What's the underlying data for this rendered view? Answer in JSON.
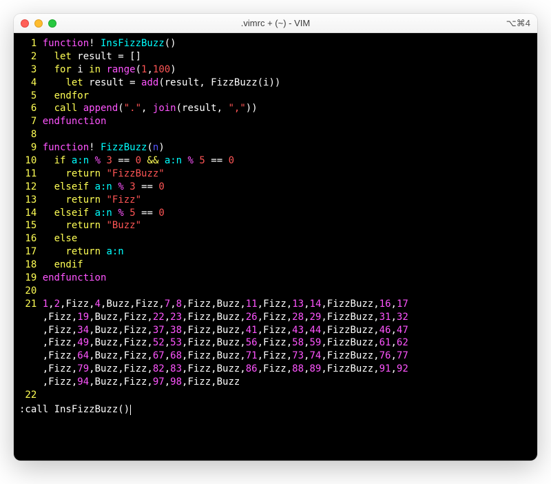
{
  "window": {
    "title": ".vimrc + (~) - VIM",
    "shortcut": "⌥⌘4"
  },
  "colors": {
    "traffic_red": "#ff5f57",
    "traffic_yellow": "#febc2e",
    "traffic_green": "#28c840",
    "bg": "#000000",
    "lineno": "#ffff55",
    "magenta": "#ff55ff",
    "cyan": "#00ffff",
    "yellow": "#ffff55",
    "white": "#ffffff",
    "red": "#ff5555",
    "blue": "#5555ff"
  },
  "editor": {
    "lines": [
      {
        "num": "1",
        "tokens": [
          {
            "t": "function",
            "c": "magenta"
          },
          {
            "t": "!",
            "c": "white"
          },
          {
            "t": " InsFizzBuzz",
            "c": "cyan"
          },
          {
            "t": "()",
            "c": "white"
          }
        ]
      },
      {
        "num": "2",
        "tokens": [
          {
            "t": "  ",
            "c": "white"
          },
          {
            "t": "let",
            "c": "yellow"
          },
          {
            "t": " result ",
            "c": "white"
          },
          {
            "t": "=",
            "c": "white"
          },
          {
            "t": " []",
            "c": "white"
          }
        ]
      },
      {
        "num": "3",
        "tokens": [
          {
            "t": "  ",
            "c": "white"
          },
          {
            "t": "for",
            "c": "yellow"
          },
          {
            "t": " i ",
            "c": "white"
          },
          {
            "t": "in",
            "c": "yellow"
          },
          {
            "t": " ",
            "c": "white"
          },
          {
            "t": "range",
            "c": "magenta"
          },
          {
            "t": "(",
            "c": "white"
          },
          {
            "t": "1",
            "c": "red"
          },
          {
            "t": ",",
            "c": "white"
          },
          {
            "t": "100",
            "c": "red"
          },
          {
            "t": ")",
            "c": "white"
          }
        ]
      },
      {
        "num": "4",
        "tokens": [
          {
            "t": "    ",
            "c": "white"
          },
          {
            "t": "let",
            "c": "yellow"
          },
          {
            "t": " result ",
            "c": "white"
          },
          {
            "t": "=",
            "c": "white"
          },
          {
            "t": " ",
            "c": "white"
          },
          {
            "t": "add",
            "c": "magenta"
          },
          {
            "t": "(result, FizzBuzz(i))",
            "c": "white"
          }
        ]
      },
      {
        "num": "5",
        "tokens": [
          {
            "t": "  ",
            "c": "white"
          },
          {
            "t": "endfor",
            "c": "yellow"
          }
        ]
      },
      {
        "num": "6",
        "tokens": [
          {
            "t": "  ",
            "c": "white"
          },
          {
            "t": "call",
            "c": "yellow"
          },
          {
            "t": " ",
            "c": "white"
          },
          {
            "t": "append",
            "c": "magenta"
          },
          {
            "t": "(",
            "c": "white"
          },
          {
            "t": "\".\"",
            "c": "red"
          },
          {
            "t": ", ",
            "c": "white"
          },
          {
            "t": "join",
            "c": "magenta"
          },
          {
            "t": "(result, ",
            "c": "white"
          },
          {
            "t": "\",\"",
            "c": "red"
          },
          {
            "t": "))",
            "c": "white"
          }
        ]
      },
      {
        "num": "7",
        "tokens": [
          {
            "t": "endfunction",
            "c": "magenta"
          }
        ]
      },
      {
        "num": "8",
        "tokens": []
      },
      {
        "num": "9",
        "tokens": [
          {
            "t": "function",
            "c": "magenta"
          },
          {
            "t": "!",
            "c": "white"
          },
          {
            "t": " FizzBuzz",
            "c": "cyan"
          },
          {
            "t": "(",
            "c": "white"
          },
          {
            "t": "n",
            "c": "blue"
          },
          {
            "t": ")",
            "c": "white"
          }
        ]
      },
      {
        "num": "10",
        "tokens": [
          {
            "t": "  ",
            "c": "white"
          },
          {
            "t": "if",
            "c": "yellow"
          },
          {
            "t": " ",
            "c": "white"
          },
          {
            "t": "a:n",
            "c": "cyan"
          },
          {
            "t": " ",
            "c": "white"
          },
          {
            "t": "%",
            "c": "magenta"
          },
          {
            "t": " ",
            "c": "white"
          },
          {
            "t": "3",
            "c": "red"
          },
          {
            "t": " ",
            "c": "white"
          },
          {
            "t": "==",
            "c": "white"
          },
          {
            "t": " ",
            "c": "white"
          },
          {
            "t": "0",
            "c": "red"
          },
          {
            "t": " ",
            "c": "white"
          },
          {
            "t": "&&",
            "c": "yellow"
          },
          {
            "t": " ",
            "c": "white"
          },
          {
            "t": "a:n",
            "c": "cyan"
          },
          {
            "t": " ",
            "c": "white"
          },
          {
            "t": "%",
            "c": "magenta"
          },
          {
            "t": " ",
            "c": "white"
          },
          {
            "t": "5",
            "c": "red"
          },
          {
            "t": " ",
            "c": "white"
          },
          {
            "t": "==",
            "c": "white"
          },
          {
            "t": " ",
            "c": "white"
          },
          {
            "t": "0",
            "c": "red"
          }
        ]
      },
      {
        "num": "11",
        "tokens": [
          {
            "t": "    ",
            "c": "white"
          },
          {
            "t": "return",
            "c": "yellow"
          },
          {
            "t": " ",
            "c": "white"
          },
          {
            "t": "\"FizzBuzz\"",
            "c": "red"
          }
        ]
      },
      {
        "num": "12",
        "tokens": [
          {
            "t": "  ",
            "c": "white"
          },
          {
            "t": "elseif",
            "c": "yellow"
          },
          {
            "t": " ",
            "c": "white"
          },
          {
            "t": "a:n",
            "c": "cyan"
          },
          {
            "t": " ",
            "c": "white"
          },
          {
            "t": "%",
            "c": "magenta"
          },
          {
            "t": " ",
            "c": "white"
          },
          {
            "t": "3",
            "c": "red"
          },
          {
            "t": " ",
            "c": "white"
          },
          {
            "t": "==",
            "c": "white"
          },
          {
            "t": " ",
            "c": "white"
          },
          {
            "t": "0",
            "c": "red"
          }
        ]
      },
      {
        "num": "13",
        "tokens": [
          {
            "t": "    ",
            "c": "white"
          },
          {
            "t": "return",
            "c": "yellow"
          },
          {
            "t": " ",
            "c": "white"
          },
          {
            "t": "\"Fizz\"",
            "c": "red"
          }
        ]
      },
      {
        "num": "14",
        "tokens": [
          {
            "t": "  ",
            "c": "white"
          },
          {
            "t": "elseif",
            "c": "yellow"
          },
          {
            "t": " ",
            "c": "white"
          },
          {
            "t": "a:n",
            "c": "cyan"
          },
          {
            "t": " ",
            "c": "white"
          },
          {
            "t": "%",
            "c": "magenta"
          },
          {
            "t": " ",
            "c": "white"
          },
          {
            "t": "5",
            "c": "red"
          },
          {
            "t": " ",
            "c": "white"
          },
          {
            "t": "==",
            "c": "white"
          },
          {
            "t": " ",
            "c": "white"
          },
          {
            "t": "0",
            "c": "red"
          }
        ]
      },
      {
        "num": "15",
        "tokens": [
          {
            "t": "    ",
            "c": "white"
          },
          {
            "t": "return",
            "c": "yellow"
          },
          {
            "t": " ",
            "c": "white"
          },
          {
            "t": "\"Buzz\"",
            "c": "red"
          }
        ]
      },
      {
        "num": "16",
        "tokens": [
          {
            "t": "  ",
            "c": "white"
          },
          {
            "t": "else",
            "c": "yellow"
          }
        ]
      },
      {
        "num": "17",
        "tokens": [
          {
            "t": "    ",
            "c": "white"
          },
          {
            "t": "return",
            "c": "yellow"
          },
          {
            "t": " ",
            "c": "white"
          },
          {
            "t": "a:n",
            "c": "cyan"
          }
        ]
      },
      {
        "num": "18",
        "tokens": [
          {
            "t": "  ",
            "c": "white"
          },
          {
            "t": "endif",
            "c": "yellow"
          }
        ]
      },
      {
        "num": "19",
        "tokens": [
          {
            "t": "endfunction",
            "c": "magenta"
          }
        ]
      },
      {
        "num": "20",
        "tokens": []
      }
    ],
    "fizzbuzz_line": {
      "num": "21",
      "rows": [
        [
          {
            "t": "1",
            "c": "magenta"
          },
          {
            "t": ",",
            "c": "white"
          },
          {
            "t": "2",
            "c": "magenta"
          },
          {
            "t": ",Fizz,",
            "c": "white"
          },
          {
            "t": "4",
            "c": "magenta"
          },
          {
            "t": ",Buzz,Fizz,",
            "c": "white"
          },
          {
            "t": "7",
            "c": "magenta"
          },
          {
            "t": ",",
            "c": "white"
          },
          {
            "t": "8",
            "c": "magenta"
          },
          {
            "t": ",Fizz,Buzz,",
            "c": "white"
          },
          {
            "t": "11",
            "c": "magenta"
          },
          {
            "t": ",Fizz,",
            "c": "white"
          },
          {
            "t": "13",
            "c": "magenta"
          },
          {
            "t": ",",
            "c": "white"
          },
          {
            "t": "14",
            "c": "magenta"
          },
          {
            "t": ",FizzBuzz,",
            "c": "white"
          },
          {
            "t": "16",
            "c": "magenta"
          },
          {
            "t": ",",
            "c": "white"
          },
          {
            "t": "17",
            "c": "magenta"
          }
        ],
        [
          {
            "t": ",Fizz,",
            "c": "white"
          },
          {
            "t": "19",
            "c": "magenta"
          },
          {
            "t": ",Buzz,Fizz,",
            "c": "white"
          },
          {
            "t": "22",
            "c": "magenta"
          },
          {
            "t": ",",
            "c": "white"
          },
          {
            "t": "23",
            "c": "magenta"
          },
          {
            "t": ",Fizz,Buzz,",
            "c": "white"
          },
          {
            "t": "26",
            "c": "magenta"
          },
          {
            "t": ",Fizz,",
            "c": "white"
          },
          {
            "t": "28",
            "c": "magenta"
          },
          {
            "t": ",",
            "c": "white"
          },
          {
            "t": "29",
            "c": "magenta"
          },
          {
            "t": ",FizzBuzz,",
            "c": "white"
          },
          {
            "t": "31",
            "c": "magenta"
          },
          {
            "t": ",",
            "c": "white"
          },
          {
            "t": "32",
            "c": "magenta"
          }
        ],
        [
          {
            "t": ",Fizz,",
            "c": "white"
          },
          {
            "t": "34",
            "c": "magenta"
          },
          {
            "t": ",Buzz,Fizz,",
            "c": "white"
          },
          {
            "t": "37",
            "c": "magenta"
          },
          {
            "t": ",",
            "c": "white"
          },
          {
            "t": "38",
            "c": "magenta"
          },
          {
            "t": ",Fizz,Buzz,",
            "c": "white"
          },
          {
            "t": "41",
            "c": "magenta"
          },
          {
            "t": ",Fizz,",
            "c": "white"
          },
          {
            "t": "43",
            "c": "magenta"
          },
          {
            "t": ",",
            "c": "white"
          },
          {
            "t": "44",
            "c": "magenta"
          },
          {
            "t": ",FizzBuzz,",
            "c": "white"
          },
          {
            "t": "46",
            "c": "magenta"
          },
          {
            "t": ",",
            "c": "white"
          },
          {
            "t": "47",
            "c": "magenta"
          }
        ],
        [
          {
            "t": ",Fizz,",
            "c": "white"
          },
          {
            "t": "49",
            "c": "magenta"
          },
          {
            "t": ",Buzz,Fizz,",
            "c": "white"
          },
          {
            "t": "52",
            "c": "magenta"
          },
          {
            "t": ",",
            "c": "white"
          },
          {
            "t": "53",
            "c": "magenta"
          },
          {
            "t": ",Fizz,Buzz,",
            "c": "white"
          },
          {
            "t": "56",
            "c": "magenta"
          },
          {
            "t": ",Fizz,",
            "c": "white"
          },
          {
            "t": "58",
            "c": "magenta"
          },
          {
            "t": ",",
            "c": "white"
          },
          {
            "t": "59",
            "c": "magenta"
          },
          {
            "t": ",FizzBuzz,",
            "c": "white"
          },
          {
            "t": "61",
            "c": "magenta"
          },
          {
            "t": ",",
            "c": "white"
          },
          {
            "t": "62",
            "c": "magenta"
          }
        ],
        [
          {
            "t": ",Fizz,",
            "c": "white"
          },
          {
            "t": "64",
            "c": "magenta"
          },
          {
            "t": ",Buzz,Fizz,",
            "c": "white"
          },
          {
            "t": "67",
            "c": "magenta"
          },
          {
            "t": ",",
            "c": "white"
          },
          {
            "t": "68",
            "c": "magenta"
          },
          {
            "t": ",Fizz,Buzz,",
            "c": "white"
          },
          {
            "t": "71",
            "c": "magenta"
          },
          {
            "t": ",Fizz,",
            "c": "white"
          },
          {
            "t": "73",
            "c": "magenta"
          },
          {
            "t": ",",
            "c": "white"
          },
          {
            "t": "74",
            "c": "magenta"
          },
          {
            "t": ",FizzBuzz,",
            "c": "white"
          },
          {
            "t": "76",
            "c": "magenta"
          },
          {
            "t": ",",
            "c": "white"
          },
          {
            "t": "77",
            "c": "magenta"
          }
        ],
        [
          {
            "t": ",Fizz,",
            "c": "white"
          },
          {
            "t": "79",
            "c": "magenta"
          },
          {
            "t": ",Buzz,Fizz,",
            "c": "white"
          },
          {
            "t": "82",
            "c": "magenta"
          },
          {
            "t": ",",
            "c": "white"
          },
          {
            "t": "83",
            "c": "magenta"
          },
          {
            "t": ",Fizz,Buzz,",
            "c": "white"
          },
          {
            "t": "86",
            "c": "magenta"
          },
          {
            "t": ",Fizz,",
            "c": "white"
          },
          {
            "t": "88",
            "c": "magenta"
          },
          {
            "t": ",",
            "c": "white"
          },
          {
            "t": "89",
            "c": "magenta"
          },
          {
            "t": ",FizzBuzz,",
            "c": "white"
          },
          {
            "t": "91",
            "c": "magenta"
          },
          {
            "t": ",",
            "c": "white"
          },
          {
            "t": "92",
            "c": "magenta"
          }
        ],
        [
          {
            "t": ",Fizz,",
            "c": "white"
          },
          {
            "t": "94",
            "c": "magenta"
          },
          {
            "t": ",Buzz,Fizz,",
            "c": "white"
          },
          {
            "t": "97",
            "c": "magenta"
          },
          {
            "t": ",",
            "c": "white"
          },
          {
            "t": "98",
            "c": "magenta"
          },
          {
            "t": ",Fizz,Buzz",
            "c": "white"
          }
        ]
      ]
    },
    "trailing_line_num": "22",
    "command": ":call InsFizzBuzz()"
  }
}
